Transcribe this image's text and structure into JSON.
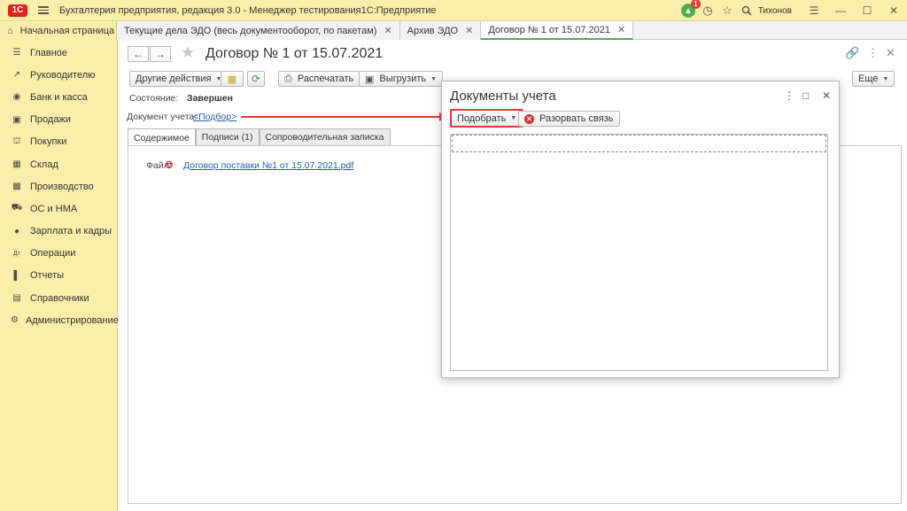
{
  "titlebar": {
    "logo": "1С",
    "title": "Бухгалтерия предприятия, редакция 3.0  - Менеджер тестирования1С:Предприятие",
    "notification_count": "1",
    "user": "Тихонов"
  },
  "tabs": [
    {
      "label": "Начальная страница"
    },
    {
      "label": "Текущие дела ЭДО (весь документооборот, по пакетам)"
    },
    {
      "label": "Архив ЭДО"
    },
    {
      "label": "Договор № 1 от 15.07.2021"
    }
  ],
  "sidebar": {
    "items": [
      {
        "label": "Главное",
        "icon": "menu-icon"
      },
      {
        "label": "Руководителю",
        "icon": "trend-icon"
      },
      {
        "label": "Банк и касса",
        "icon": "coin-icon"
      },
      {
        "label": "Продажи",
        "icon": "bag-icon"
      },
      {
        "label": "Покупки",
        "icon": "cart-icon"
      },
      {
        "label": "Склад",
        "icon": "warehouse-icon"
      },
      {
        "label": "Производство",
        "icon": "factory-icon"
      },
      {
        "label": "ОС и НМА",
        "icon": "truck-icon"
      },
      {
        "label": "Зарплата и кадры",
        "icon": "person-icon"
      },
      {
        "label": "Операции",
        "icon": "operations-icon"
      },
      {
        "label": "Отчеты",
        "icon": "chart-icon"
      },
      {
        "label": "Справочники",
        "icon": "books-icon"
      },
      {
        "label": "Администрирование",
        "icon": "gear-icon"
      }
    ]
  },
  "form": {
    "title": "Договор № 1 от 15.07.2021",
    "toolbar": {
      "other_actions": "Другие действия",
      "print": "Распечатать",
      "export": "Выгрузить",
      "more": "Еще"
    },
    "state_label": "Состояние:",
    "state_value": "Завершен",
    "doc_label": "Документ учета:",
    "doc_link": "<Подбор>",
    "tabs": [
      "Содержимое",
      "Подписи (1)",
      "Сопроводительная записка"
    ],
    "file_label": "Файл:",
    "file_link": "Договор поставки №1 от 15.07.2021.pdf"
  },
  "dialog": {
    "title": "Документы учета",
    "select_button": "Подобрать",
    "unlink_button": "Разорвать связь"
  },
  "colors": {
    "sidebar_bg": "#fbeeaa",
    "accent_red": "#e53935",
    "active_tab_underline": "#4caf50",
    "link": "#2a5db0"
  }
}
